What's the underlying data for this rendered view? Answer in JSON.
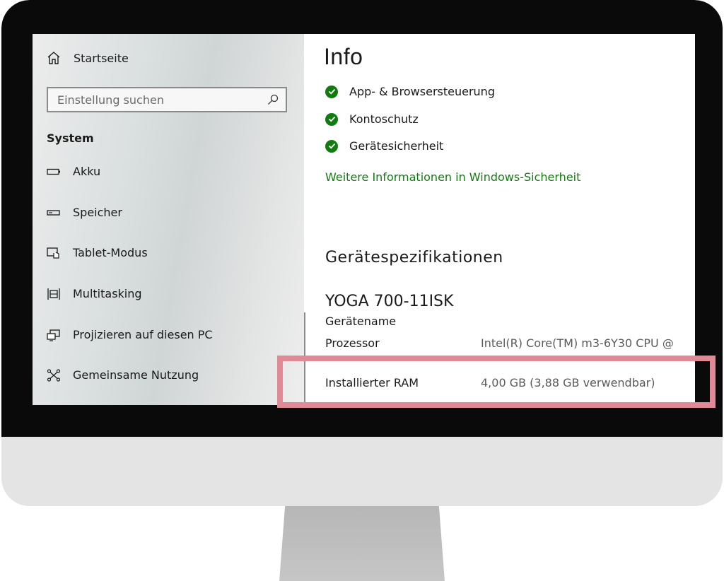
{
  "sidebar": {
    "home_label": "Startseite",
    "search_placeholder": "Einstellung suchen",
    "section_title": "System",
    "items": [
      {
        "label": "Akku",
        "icon": "battery-icon"
      },
      {
        "label": "Speicher",
        "icon": "storage-icon"
      },
      {
        "label": "Tablet-Modus",
        "icon": "tablet-mode-icon"
      },
      {
        "label": "Multitasking",
        "icon": "multitasking-icon"
      },
      {
        "label": "Projizieren auf diesen PC",
        "icon": "project-icon"
      },
      {
        "label": "Gemeinsame Nutzung",
        "icon": "share-icon"
      }
    ]
  },
  "content": {
    "title": "Info",
    "status_items": [
      {
        "label": "App- & Browsersteuerung",
        "icon": "check-circle-icon"
      },
      {
        "label": "Kontoschutz",
        "icon": "check-circle-icon"
      },
      {
        "label": "Gerätesicherheit",
        "icon": "check-circle-icon"
      }
    ],
    "security_link": "Weitere Informationen in Windows-Sicherheit",
    "specs_title": "Gerätespezifikationen",
    "device_name": "YOGA 700-11ISK",
    "device_name_label": "Gerätename",
    "specs": [
      {
        "label": "Prozessor",
        "value": "Intel(R) Core(TM) m3-6Y30 CPU @"
      },
      {
        "label": "Installierter RAM",
        "value": "4,00 GB (3,88 GB verwendbar)"
      }
    ]
  },
  "colors": {
    "accent_green": "#107c10",
    "highlight_pink": "#e08a97",
    "bezel": "#0a0a0a"
  }
}
